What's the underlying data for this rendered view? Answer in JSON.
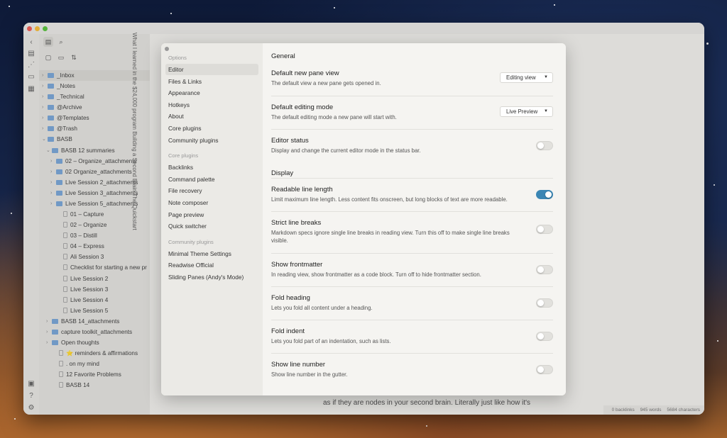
{
  "vertical_title": "What I learned in the $24,000 program Building a Second Brain  The Quickstart",
  "editor_snippet": "as if they are nodes in your second brain. Literally just like how it's",
  "status": {
    "backlinks": "0 backlinks",
    "words": "945 words",
    "characters": "5684 characters"
  },
  "tree": [
    {
      "label": "_Inbox",
      "type": "folder",
      "depth": 0,
      "expanded": false
    },
    {
      "label": "_Notes",
      "type": "folder",
      "depth": 0,
      "expanded": false
    },
    {
      "label": "_Technical",
      "type": "folder",
      "depth": 0,
      "expanded": false
    },
    {
      "label": "@Archive",
      "type": "folder",
      "depth": 0,
      "expanded": false
    },
    {
      "label": "@Templates",
      "type": "folder",
      "depth": 0,
      "expanded": false
    },
    {
      "label": "@Trash",
      "type": "folder",
      "depth": 0,
      "expanded": false
    },
    {
      "label": "BASB",
      "type": "folder",
      "depth": 0,
      "expanded": true
    },
    {
      "label": "BASB 12 summaries",
      "type": "folder",
      "depth": 1,
      "expanded": true
    },
    {
      "label": "02 – Organize_attachments",
      "type": "folder",
      "depth": 2,
      "expanded": false
    },
    {
      "label": "02 Organize_attachments",
      "type": "folder",
      "depth": 2,
      "expanded": false
    },
    {
      "label": "Live Session 2_attachments",
      "type": "folder",
      "depth": 2,
      "expanded": false
    },
    {
      "label": "Live Session 3_attachments",
      "type": "folder",
      "depth": 2,
      "expanded": false
    },
    {
      "label": "Live Session 5_attachments",
      "type": "folder",
      "depth": 2,
      "expanded": false
    },
    {
      "label": "01 – Capture",
      "type": "file",
      "depth": 2
    },
    {
      "label": "02 – Organize",
      "type": "file",
      "depth": 2
    },
    {
      "label": "03 – Distill",
      "type": "file",
      "depth": 2
    },
    {
      "label": "04 – Express",
      "type": "file",
      "depth": 2
    },
    {
      "label": "Ali Session 3",
      "type": "file",
      "depth": 2
    },
    {
      "label": "Checklist for starting a new pr",
      "type": "file",
      "depth": 2
    },
    {
      "label": "Live Session 2",
      "type": "file",
      "depth": 2
    },
    {
      "label": "Live Session 3",
      "type": "file",
      "depth": 2
    },
    {
      "label": "Live Session 4",
      "type": "file",
      "depth": 2
    },
    {
      "label": "Live Session 5",
      "type": "file",
      "depth": 2
    },
    {
      "label": "BASB 14_attachments",
      "type": "folder",
      "depth": 1,
      "expanded": false
    },
    {
      "label": "capture toolkit_attachments",
      "type": "folder",
      "depth": 1,
      "expanded": false
    },
    {
      "label": "Open thoughts",
      "type": "folder",
      "depth": 1,
      "expanded": false
    },
    {
      "label": "⭐ reminders & affirmations",
      "type": "file",
      "depth": 1
    },
    {
      "label": ". on my mind",
      "type": "file",
      "depth": 1
    },
    {
      "label": "12 Favorite Problems",
      "type": "file",
      "depth": 1
    },
    {
      "label": "BASB 14",
      "type": "file",
      "depth": 1
    }
  ],
  "modal": {
    "nav_sections": [
      {
        "heading": "Options",
        "items": [
          "Editor",
          "Files & Links",
          "Appearance",
          "Hotkeys",
          "About",
          "Core plugins",
          "Community plugins"
        ]
      },
      {
        "heading": "Core plugins",
        "items": [
          "Backlinks",
          "Command palette",
          "File recovery",
          "Note composer",
          "Page preview",
          "Quick switcher"
        ]
      },
      {
        "heading": "Community plugins",
        "items": [
          "Minimal Theme Settings",
          "Readwise Official",
          "Sliding Panes (Andy's Mode)"
        ]
      }
    ],
    "active_item": "Editor",
    "general_heading": "General",
    "display_heading": "Display",
    "general_settings": [
      {
        "name": "Default new pane view",
        "desc": "The default view a new pane gets opened in.",
        "control": "dropdown",
        "value": "Editing view"
      },
      {
        "name": "Default editing mode",
        "desc": "The default editing mode a new pane will start with.",
        "control": "dropdown",
        "value": "Live Preview"
      },
      {
        "name": "Editor status",
        "desc": "Display and change the current editor mode in the status bar.",
        "control": "toggle",
        "on": false
      }
    ],
    "display_settings": [
      {
        "name": "Readable line length",
        "desc": "Limit maximum line length. Less content fits onscreen, but long blocks of text are more readable.",
        "control": "toggle",
        "on": true
      },
      {
        "name": "Strict line breaks",
        "desc": "Markdown specs ignore single line breaks in reading view. Turn this off to make single line breaks visible.",
        "control": "toggle",
        "on": false
      },
      {
        "name": "Show frontmatter",
        "desc": "In reading view, show frontmatter as a code block. Turn off to hide frontmatter section.",
        "control": "toggle",
        "on": false
      },
      {
        "name": "Fold heading",
        "desc": "Lets you fold all content under a heading.",
        "control": "toggle",
        "on": false
      },
      {
        "name": "Fold indent",
        "desc": "Lets you fold part of an indentation, such as lists.",
        "control": "toggle",
        "on": false
      },
      {
        "name": "Show line number",
        "desc": "Show line number in the gutter.",
        "control": "toggle",
        "on": false
      }
    ]
  }
}
